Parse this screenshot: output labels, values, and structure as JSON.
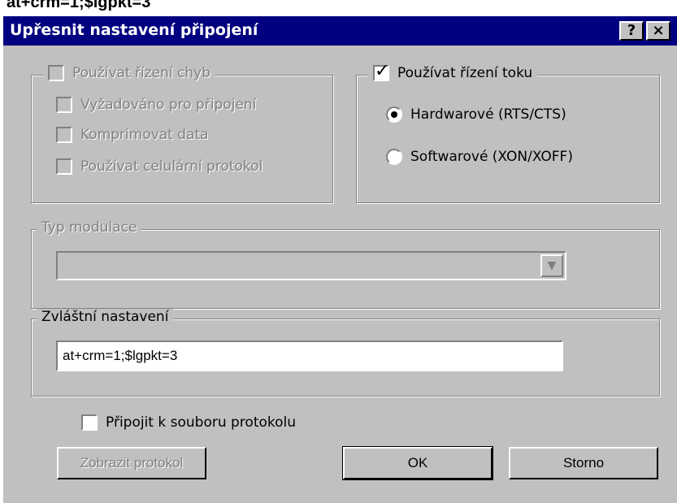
{
  "top_text": "at+crm=1;$lgpkt=3",
  "titlebar": {
    "title": "Upřesnit nastavení připojení",
    "help_label": "?",
    "close_label": "×"
  },
  "error_control": {
    "label": "Používat řízení chyb",
    "items": [
      "Vyžadováno pro připojení",
      "Komprimovat data",
      "Používat celulární protokol"
    ]
  },
  "flow_control": {
    "label": "Používat řízení toku",
    "options": [
      "Hardwarové (RTS/CTS)",
      "Softwarové (XON/XOFF)"
    ]
  },
  "modulation": {
    "label": "Typ modulace",
    "value": ""
  },
  "extra_settings": {
    "label": "Zvláštní nastavení",
    "value": "at+crm=1;$lgpkt=3"
  },
  "log": {
    "append_label": "Připojit k souboru protokolu",
    "view_button": "Zobrazit protokol"
  },
  "buttons": {
    "ok": "OK",
    "cancel": "Storno"
  }
}
